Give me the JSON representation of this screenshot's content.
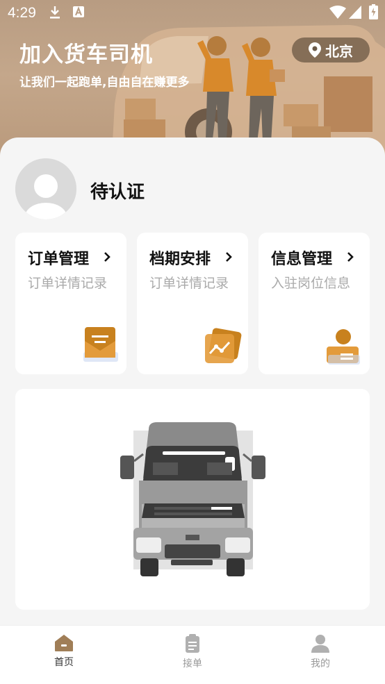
{
  "status_bar": {
    "time": "4:29"
  },
  "hero": {
    "title": "加入货车司机",
    "subtitle": "让我们一起跑单,自由自在赚更多",
    "city": "北京"
  },
  "profile": {
    "status": "待认证"
  },
  "menu": [
    {
      "title": "订单管理",
      "subtitle": "订单详情记录",
      "icon": "envelope-icon"
    },
    {
      "title": "档期安排",
      "subtitle": "订单详情记录",
      "icon": "chart-card-icon"
    },
    {
      "title": "信息管理",
      "subtitle": "入驻岗位信息",
      "icon": "person-card-icon"
    }
  ],
  "bottom_nav": [
    {
      "label": "首页",
      "icon": "home-icon",
      "active": true
    },
    {
      "label": "接单",
      "icon": "clipboard-icon",
      "active": false
    },
    {
      "label": "我的",
      "icon": "user-icon",
      "active": false
    }
  ],
  "colors": {
    "accent": "#c8811e",
    "nav_active": "#a07e57",
    "nav_inactive": "#b0b0b0"
  }
}
